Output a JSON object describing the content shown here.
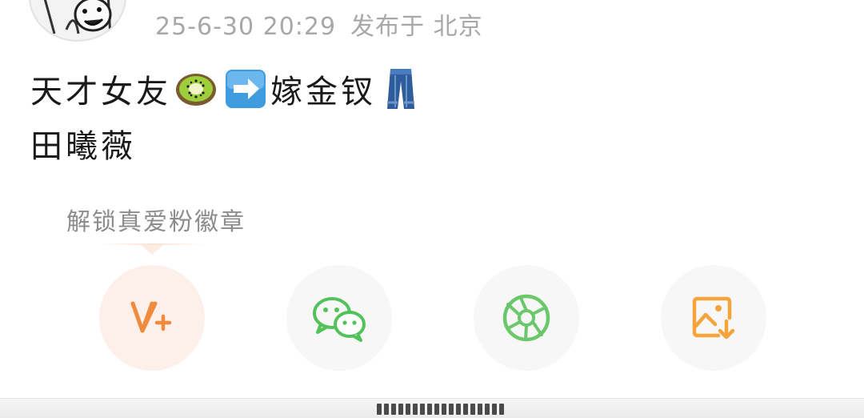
{
  "post": {
    "timestamp": "25-6-30 20:29",
    "location": "发布于 北京",
    "line1_text_a": "天才女友",
    "line1_text_b": "嫁金钗",
    "line2_text": "田曦薇",
    "emojis": [
      "kiwi-emoji",
      "right-arrow-emoji",
      "jeans-emoji"
    ]
  },
  "badge": {
    "hint": "解锁真爱粉徽章"
  },
  "share": {
    "buttons": [
      "vplus-icon",
      "wechat-icon",
      "moments-icon",
      "save-image-icon"
    ]
  },
  "colors": {
    "vplus_orange": "#f08a3c",
    "wechat_green": "#54c25a",
    "moments_green": "#6bc86a",
    "save_orange": "#f4a43a",
    "text_primary": "#1a1a1a",
    "text_meta": "#a8a8a8"
  }
}
